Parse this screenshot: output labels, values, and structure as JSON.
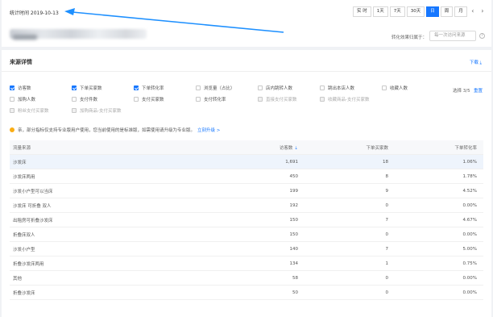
{
  "top": {
    "stat_time": "统计时间 2019-10-13",
    "ranges": [
      {
        "label": "实 时",
        "active": false
      },
      {
        "label": "1天",
        "active": false
      },
      {
        "label": "7天",
        "active": false
      },
      {
        "label": "30天",
        "active": false
      },
      {
        "label": "日",
        "active": true
      },
      {
        "label": "周",
        "active": false
      },
      {
        "label": "月",
        "active": false
      }
    ],
    "prev_icon": "‹",
    "next_icon": "›",
    "attribution_label": "转化效果归属于：",
    "attribution_value": "每一次访问来源",
    "help_icon": "?"
  },
  "main": {
    "title": "来源详情",
    "download": "下载 ⤓",
    "metrics": [
      {
        "label": "访客数",
        "checked": true,
        "disabled": false
      },
      {
        "label": "下单买家数",
        "checked": true,
        "disabled": false
      },
      {
        "label": "下单转化率",
        "checked": true,
        "disabled": false
      },
      {
        "label": "浏览量（占比）",
        "checked": false,
        "disabled": false
      },
      {
        "label": "店内跳转人数",
        "checked": false,
        "disabled": false
      },
      {
        "label": "跳出本店人数",
        "checked": false,
        "disabled": false
      },
      {
        "label": "收藏人数",
        "checked": false,
        "disabled": false
      },
      {
        "label": "加购人数",
        "checked": false,
        "disabled": false
      },
      {
        "label": "支付件数",
        "checked": false,
        "disabled": false
      },
      {
        "label": "支付买家数",
        "checked": false,
        "disabled": false
      },
      {
        "label": "支付转化率",
        "checked": false,
        "disabled": false
      },
      {
        "label": "直接支付买家数",
        "checked": false,
        "disabled": true
      },
      {
        "label": "收藏商品-支付买家数",
        "checked": false,
        "disabled": true
      },
      {
        "label": "粉丝支付买家数",
        "checked": false,
        "disabled": true
      },
      {
        "label": "加购商品-支付买家数",
        "checked": false,
        "disabled": true
      }
    ],
    "select_count": "选择 3/5",
    "reset": "重置",
    "notice": "亲，部分指标仅支持专业版用户使用，您当前使用的是标准版，如需使用请升级为专业版。",
    "notice_link": "立刻升级 >",
    "table": {
      "headers": [
        "流量来源",
        "访客数",
        "下单买家数",
        "下单转化率"
      ],
      "sort_icon": "⇣",
      "rows": [
        [
          "沙发床",
          "1,691",
          "18",
          "1.06%"
        ],
        [
          "沙发床两用",
          "450",
          "8",
          "1.78%"
        ],
        [
          "沙发小户型可以当床",
          "199",
          "9",
          "4.52%"
        ],
        [
          "沙发床 可折叠 双人",
          "192",
          "0",
          "0.00%"
        ],
        [
          "出租房可折叠沙发床",
          "150",
          "7",
          "4.67%"
        ],
        [
          "折叠床双人",
          "150",
          "0",
          "0.00%"
        ],
        [
          "沙发小户型",
          "140",
          "7",
          "5.00%"
        ],
        [
          "折叠沙发床两用",
          "134",
          "1",
          "0.75%"
        ],
        [
          "其他",
          "58",
          "0",
          "0.00%"
        ],
        [
          "折叠沙发床",
          "50",
          "0",
          "0.00%"
        ]
      ]
    }
  }
}
